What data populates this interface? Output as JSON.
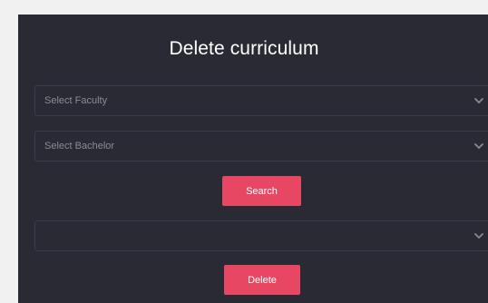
{
  "page": {
    "title": "Delete curriculum"
  },
  "form": {
    "faculty_select": {
      "selected": "Select Faculty",
      "icon": "chevron-down-icon"
    },
    "bachelor_select": {
      "selected": "Select Bachelor",
      "icon": "chevron-down-icon"
    },
    "search_label": "Search",
    "curriculum_select": {
      "selected": "",
      "icon": "chevron-down-icon"
    },
    "delete_label": "Delete"
  },
  "colors": {
    "background": "#f1f1f2",
    "panel": "#2a2a35",
    "accent": "#e84763",
    "field_border": "#3c3c48",
    "placeholder_text": "#8b8b95"
  }
}
